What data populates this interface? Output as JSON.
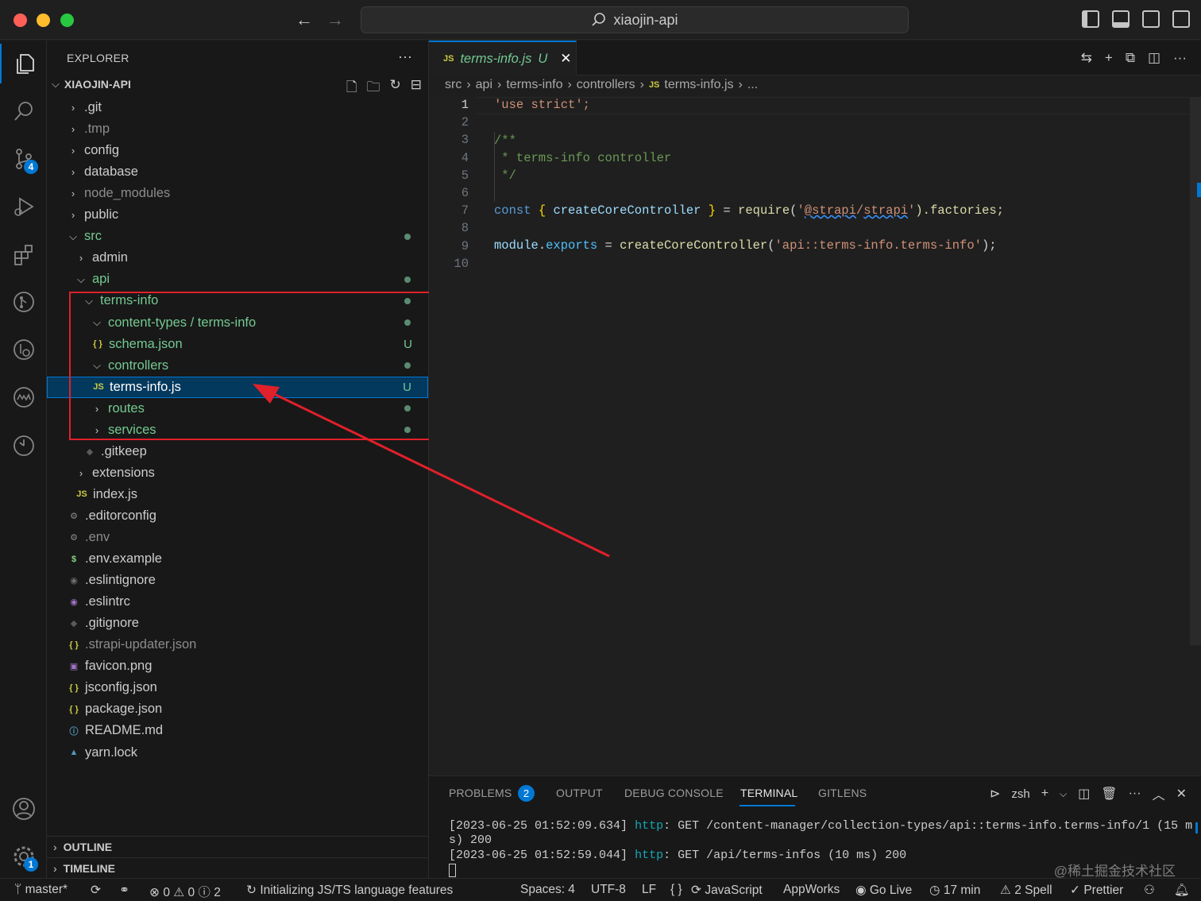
{
  "window": {
    "search_title": "xiaojin-api"
  },
  "activity_badges": {
    "source_control": "4",
    "settings": "1"
  },
  "explorer": {
    "title": "EXPLORER",
    "more": "···",
    "root": "XIAOJIN-API",
    "rows": [
      {
        "label": ".git",
        "level": 0,
        "twisty": ">",
        "color": "c-norm"
      },
      {
        "label": ".tmp",
        "level": 0,
        "twisty": ">",
        "color": "c-dim"
      },
      {
        "label": "config",
        "level": 0,
        "twisty": ">",
        "color": "c-norm"
      },
      {
        "label": "database",
        "level": 0,
        "twisty": ">",
        "color": "c-norm"
      },
      {
        "label": "node_modules",
        "level": 0,
        "twisty": ">",
        "color": "c-dim"
      },
      {
        "label": "public",
        "level": 0,
        "twisty": ">",
        "color": "c-norm"
      },
      {
        "label": "src",
        "level": 0,
        "twisty": "v",
        "color": "c-green",
        "dot": true
      },
      {
        "label": "admin",
        "level": 1,
        "twisty": ">",
        "color": "c-norm"
      },
      {
        "label": "api",
        "level": 1,
        "twisty": "v",
        "color": "c-green",
        "dot": true
      },
      {
        "label": "terms-info",
        "level": 2,
        "twisty": "v",
        "color": "c-green",
        "dot": true
      },
      {
        "label": "content-types / terms-info",
        "level": 3,
        "twisty": "v",
        "color": "c-green",
        "dot": true
      },
      {
        "label": "schema.json",
        "level": 3,
        "icon": "{ }",
        "iconColor": "#cbcb41",
        "color": "c-green",
        "status": "U"
      },
      {
        "label": "controllers",
        "level": 3,
        "twisty": "v",
        "color": "c-green",
        "dot": true
      },
      {
        "label": "terms-info.js",
        "level": 3,
        "icon": "JS",
        "iconColor": "#cbcb41",
        "color": "c-white",
        "status": "U",
        "selected": true
      },
      {
        "label": "routes",
        "level": 3,
        "twisty": ">",
        "color": "c-green",
        "dot": true
      },
      {
        "label": "services",
        "level": 3,
        "twisty": ">",
        "color": "c-green",
        "dot": true
      },
      {
        "label": ".gitkeep",
        "level": 2,
        "icon": "◆",
        "iconColor": "#5a5a5a",
        "color": "c-norm"
      },
      {
        "label": "extensions",
        "level": 1,
        "twisty": ">",
        "color": "c-norm"
      },
      {
        "label": "index.js",
        "level": 1,
        "icon": "JS",
        "iconColor": "#cbcb41",
        "color": "c-norm"
      },
      {
        "label": ".editorconfig",
        "level": 0,
        "icon": "⚙",
        "iconColor": "#8c8c8c",
        "color": "c-norm"
      },
      {
        "label": ".env",
        "level": 0,
        "icon": "⚙",
        "iconColor": "#8c8c8c",
        "color": "c-dim"
      },
      {
        "label": ".env.example",
        "level": 0,
        "icon": "$",
        "iconColor": "#89d185",
        "color": "c-norm"
      },
      {
        "label": ".eslintignore",
        "level": 0,
        "icon": "◉",
        "iconColor": "#6d6d6d",
        "color": "c-norm"
      },
      {
        "label": ".eslintrc",
        "level": 0,
        "icon": "◉",
        "iconColor": "#a074c4",
        "color": "c-norm"
      },
      {
        "label": ".gitignore",
        "level": 0,
        "icon": "◆",
        "iconColor": "#5a5a5a",
        "color": "c-norm"
      },
      {
        "label": ".strapi-updater.json",
        "level": 0,
        "icon": "{ }",
        "iconColor": "#cbcb41",
        "color": "c-dim"
      },
      {
        "label": "favicon.png",
        "level": 0,
        "icon": "▣",
        "iconColor": "#a074c4",
        "color": "c-norm"
      },
      {
        "label": "jsconfig.json",
        "level": 0,
        "icon": "{ }",
        "iconColor": "#cbcb41",
        "color": "c-norm"
      },
      {
        "label": "package.json",
        "level": 0,
        "icon": "{ }",
        "iconColor": "#cbcb41",
        "color": "c-norm"
      },
      {
        "label": "README.md",
        "level": 0,
        "icon": "ⓘ",
        "iconColor": "#519aba",
        "color": "c-norm"
      },
      {
        "label": "yarn.lock",
        "level": 0,
        "icon": "▲",
        "iconColor": "#519aba",
        "color": "c-norm"
      }
    ],
    "outline": "OUTLINE",
    "timeline": "TIMELINE"
  },
  "tab": {
    "icon": "JS",
    "label": "terms-info.js",
    "status": "U",
    "close": "✕"
  },
  "breadcrumb": {
    "parts": [
      "src",
      "api",
      "terms-info",
      "controllers"
    ],
    "file_icon": "JS",
    "file": "terms-info.js",
    "tail": "..."
  },
  "editor": {
    "line_numbers": [
      "1",
      "2",
      "3",
      "4",
      "5",
      "6",
      "7",
      "8",
      "9",
      "10"
    ],
    "line1": "'use strict';",
    "line3": "/**",
    "line4": " * terms-info controller",
    "line5": " */",
    "l7_const": "const",
    "l7_open": "{",
    "l7_fn": "createCoreController",
    "l7_close": "}",
    "l7_eq": "=",
    "l7_require": "require",
    "l7_s1": "'",
    "l7_sq1": "@strapi",
    "l7_slash": "/",
    "l7_sq2": "strapi",
    "l7_s2": "'",
    "l7_tail": ").factories;",
    "l7_paren": "(",
    "l9_module": "module",
    "l9_dot": ".",
    "l9_exports": "exports",
    "l9_eq": " = ",
    "l9_fn": "createCoreController",
    "l9_paren": "(",
    "l9_str": "'api::terms-info.terms-info'",
    "l9_end": ");"
  },
  "panel": {
    "tabs": [
      "PROBLEMS",
      "OUTPUT",
      "DEBUG CONSOLE",
      "TERMINAL",
      "GITLENS"
    ],
    "problems_count": "2",
    "shell": "zsh",
    "log1_time": "[2023-06-25 01:52:09.634]",
    "log1_http": "http",
    "log1_rest": ": GET /content-manager/collection-types/api::terms-info.terms-info/1 (15 m",
    "log1_wrap": "s) 200",
    "log2_time": "[2023-06-25 01:52:59.044]",
    "log2_http": "http",
    "log2_rest": ": GET /api/terms-infos (10 ms) 200",
    "watermark": "@稀土掘金技术社区"
  },
  "statusbar": {
    "branch": "master*",
    "errors": "0",
    "warnings": "0",
    "info": "2",
    "task": "Initializing JS/TS language features",
    "spaces": "Spaces: 4",
    "encoding": "UTF-8",
    "eol": "LF",
    "braces": "{ }",
    "language": "JavaScript",
    "appworks": "AppWorks",
    "golive": "Go Live",
    "time": "17 min",
    "spell": "2 Spell",
    "prettier": "Prettier"
  }
}
